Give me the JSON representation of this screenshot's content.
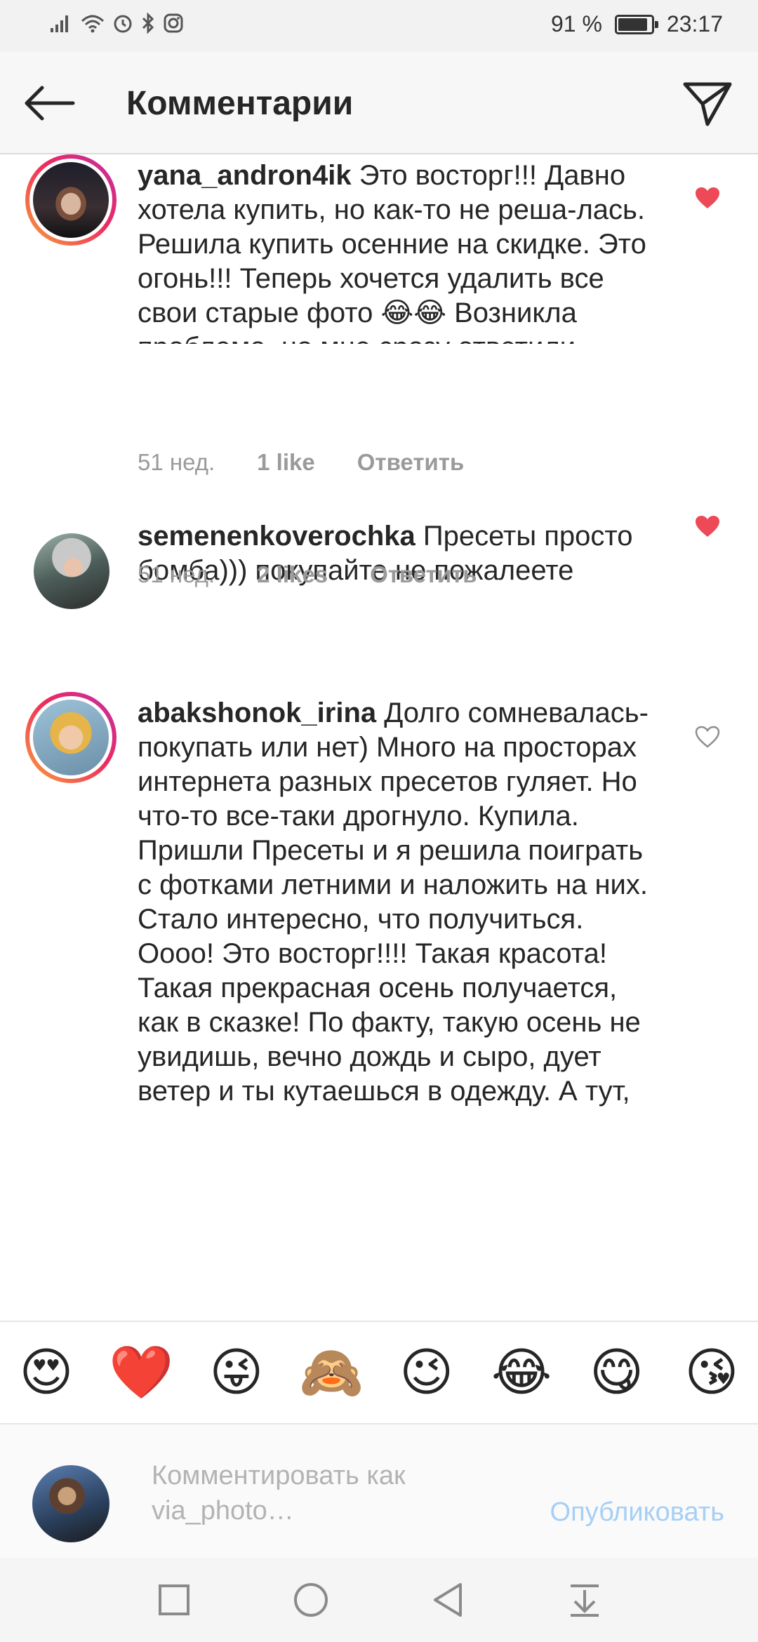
{
  "status_bar": {
    "battery_text": "91 %",
    "time": "23:17",
    "battery_level": 0.91
  },
  "header": {
    "title": "Комментарии",
    "back_icon": "arrow-left-icon",
    "send_icon": "paper-plane-icon"
  },
  "comments": [
    {
      "username": "yana_andron4ik",
      "text": "Это восторг!!! Давно хотела купить, но как-то не реша-лась. Решила купить осенние на скидке. Это огонь!!! Теперь хочется удалить все свои старые фото 😂😂 Возникла проблема, но мне сразу ответили, помогли с установкой. Огромное спасибо, ребята!!!!!",
      "time": "51 нед.",
      "likes": "1 like",
      "reply": "Ответить",
      "liked": true,
      "has_story_ring": true
    },
    {
      "username": "semenenkoverochka",
      "text": "Пресеты просто бомба))) покупайте не пожалеете",
      "time": "51 нед.",
      "likes": "2 likes",
      "reply": "Ответить",
      "liked": true,
      "has_story_ring": false
    },
    {
      "username": "abakshonok_irina",
      "text": "Долго сомневалась-покупать или нет) Много на просторах интернета разных пресетов гуляет. Но что-то все-таки дрогнуло. Купила. Пришли Пресеты и я решила поиграть с фотками летними и наложить на них. Стало интересно, что получиться. Оооо! Это восторг!!!! Такая красота! Такая прекрасная осень получается, как в сказке! По факту, такую осень не увидишь, вечно дождь и сыро, дует ветер и ты кутаешься в одежду. А тут, это прекрасно! Даже летние фото становятся такими красивыми осенними. Я кайфую! Спасибо вам за такую красоту! А что же будет зимой? Уже в предвкушении 😁",
      "liked": false,
      "has_story_ring": true
    }
  ],
  "emoji_bar": [
    "😍",
    "❤️",
    "😜",
    "🙈",
    "😉",
    "😂",
    "😋",
    "😘"
  ],
  "composer": {
    "placeholder": "Комментировать как via_photo…",
    "publish": "Опубликовать"
  },
  "colors": {
    "like_red": "#ed4956",
    "link_blue": "#a6cff5",
    "muted_text": "#9a9a9a"
  }
}
